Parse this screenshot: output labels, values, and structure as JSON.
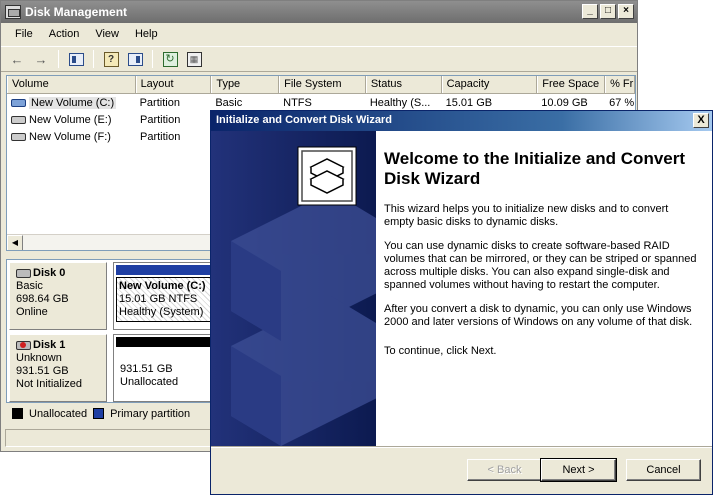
{
  "dm": {
    "title": "Disk Management",
    "menu": [
      "File",
      "Action",
      "View",
      "Help"
    ],
    "toolbar": {
      "back_icon": "←",
      "forward_icon": "→",
      "help_glyph": "?"
    },
    "columns": [
      "Volume",
      "Layout",
      "Type",
      "File System",
      "Status",
      "Capacity",
      "Free Space",
      "% Fr"
    ],
    "volumes": [
      {
        "name": "New Volume (C:)",
        "layout": "Partition",
        "type": "Basic",
        "fs": "NTFS",
        "status": "Healthy (S...",
        "capacity": "15.01 GB",
        "free": "10.09 GB",
        "pct": "67 %"
      },
      {
        "name": "New Volume (E:)",
        "layout": "Partition"
      },
      {
        "name": "New Volume (F:)",
        "layout": "Partition"
      }
    ],
    "disks": [
      {
        "name": "Disk 0",
        "type": "Basic",
        "size": "698.64 GB",
        "state": "Online",
        "partition": {
          "label": "New Volume  (C:)",
          "size_fs": "15.01 GB NTFS",
          "status": "Healthy (System)"
        }
      },
      {
        "name": "Disk 1",
        "type": "Unknown",
        "size": "931.51 GB",
        "state": "Not Initialized",
        "partition": {
          "size": "931.51 GB",
          "status": "Unallocated"
        }
      }
    ],
    "legend": {
      "unallocated": "Unallocated",
      "primary": "Primary partition"
    },
    "colors": {
      "primary": "#1f3fa3",
      "unallocated": "#000000"
    }
  },
  "wizard": {
    "title": "Initialize and Convert Disk Wizard",
    "close_glyph": "X",
    "heading": "Welcome to the Initialize and Convert Disk Wizard",
    "paragraphs": [
      "This wizard helps you to initialize new disks and to convert empty basic disks to dynamic disks.",
      "You can use dynamic disks to create software-based RAID volumes that can be mirrored, or they can be striped or spanned across multiple disks. You can also expand single-disk and spanned volumes without having to restart the computer.",
      "After you convert a disk to dynamic, you can only use Windows 2000 and later versions of Windows on any volume of that disk.",
      "To continue, click Next."
    ],
    "buttons": {
      "back": "< Back",
      "next": "Next >",
      "cancel": "Cancel"
    }
  }
}
